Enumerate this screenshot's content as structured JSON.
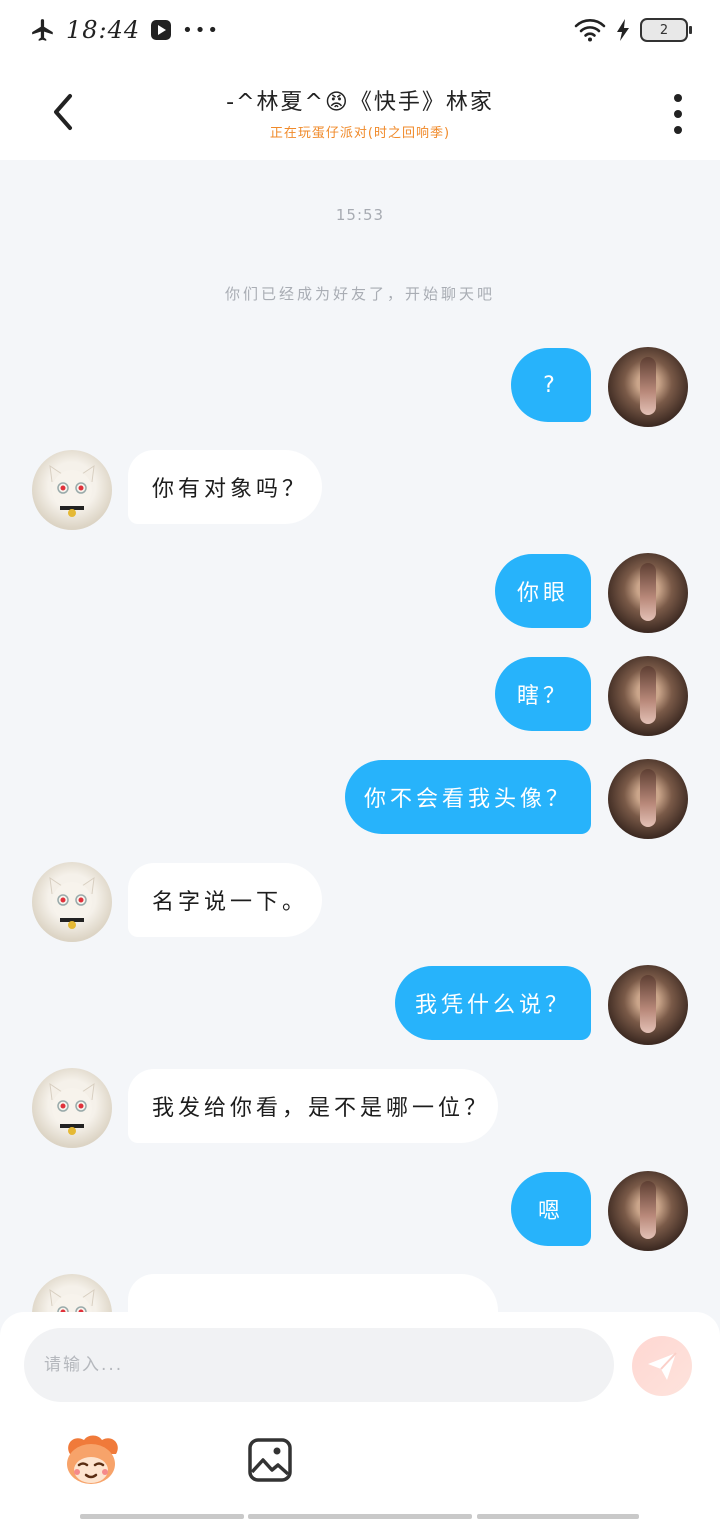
{
  "status_bar": {
    "time": "18:44",
    "more_dots": "•••",
    "battery_level": "2"
  },
  "header": {
    "title": "-^林夏^😡《快手》林家",
    "subtitle": "正在玩蛋仔派对(时之回响季)"
  },
  "chat": {
    "timestamp": "15:53",
    "system_message": "你们已经成为好友了，开始聊天吧",
    "messages": [
      {
        "from": "self",
        "text": "?"
      },
      {
        "from": "other",
        "text": "你有对象吗？"
      },
      {
        "from": "self",
        "text": "你眼"
      },
      {
        "from": "self",
        "text": "瞎？"
      },
      {
        "from": "self",
        "text": "你不会看我头像？"
      },
      {
        "from": "other",
        "text": "名字说一下。"
      },
      {
        "from": "self",
        "text": "我凭什么说？"
      },
      {
        "from": "other",
        "text": "我发给你看，是不是哪一位？"
      },
      {
        "from": "self",
        "text": "嗯"
      },
      {
        "from": "other",
        "text": ""
      }
    ]
  },
  "composer": {
    "placeholder": "请输入...",
    "value": ""
  },
  "icons": {
    "back": "back-arrow-icon",
    "more": "more-vertical-icon",
    "send": "send-icon",
    "emoji": "emoji-character-icon",
    "image": "image-icon"
  },
  "colors": {
    "self_bubble": "#27b3fb",
    "other_bubble": "#ffffff",
    "subtitle": "#f08a2a",
    "background": "#f4f6f9"
  }
}
